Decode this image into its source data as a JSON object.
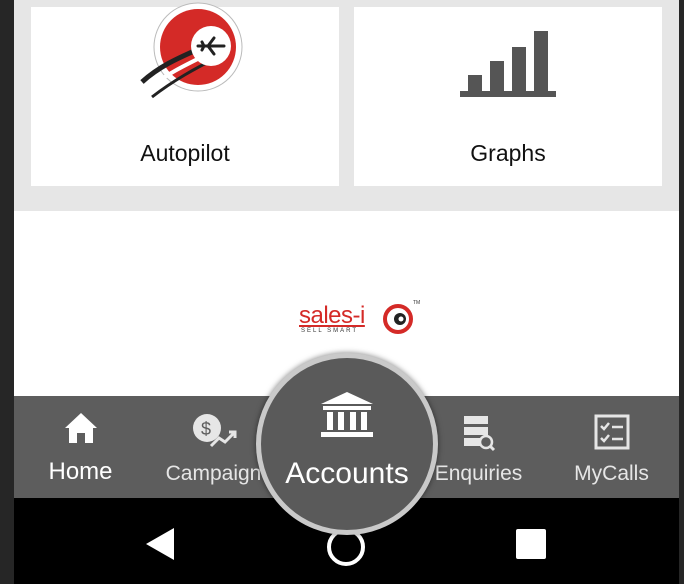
{
  "tiles": [
    {
      "label": "Autopilot",
      "icon": "autopilot-plane-icon"
    },
    {
      "label": "Graphs",
      "icon": "bar-graph-icon"
    }
  ],
  "logo": {
    "word": "sales-i",
    "tagline": "SELL SMART",
    "mark": "TM"
  },
  "tabs": [
    {
      "label": "Home",
      "icon": "home-icon"
    },
    {
      "label": "Campaign",
      "icon": "campaign-icon"
    },
    {
      "label": "Accounts",
      "icon": "bank-icon"
    },
    {
      "label": "Enquiries",
      "icon": "enquiries-icon"
    },
    {
      "label": "MyCalls",
      "icon": "checklist-icon"
    }
  ],
  "navbar": {
    "back": "back-icon",
    "home": "home-circle-icon",
    "recents": "recents-icon"
  },
  "colors": {
    "brand_red": "#d42a27",
    "tabbar": "#5d5d5d",
    "bars": "#555555"
  }
}
